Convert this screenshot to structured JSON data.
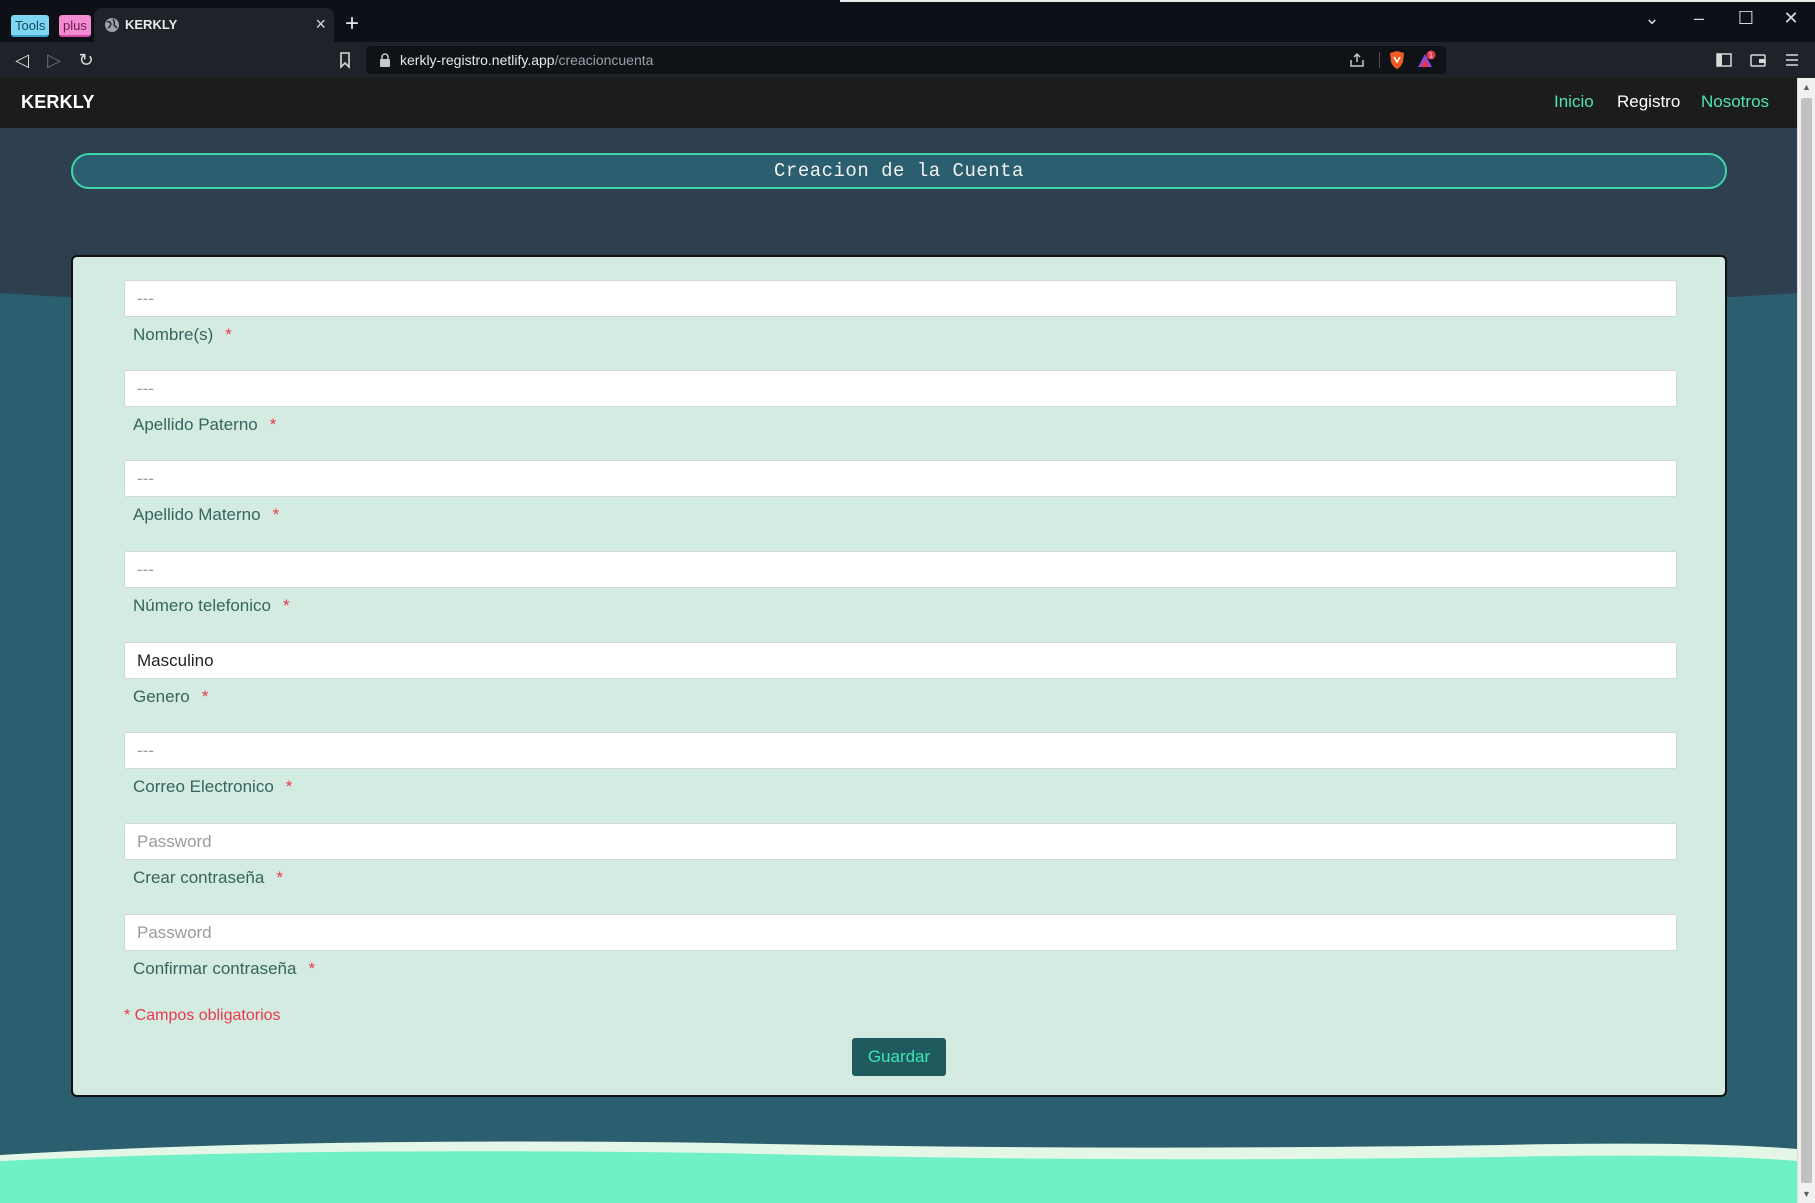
{
  "browser": {
    "tab_groups": [
      "Tools",
      "plus"
    ],
    "active_tab_title": "KERKLY",
    "url_host": "kerkly-registro.netlify.app",
    "url_path": "/creacioncuenta",
    "badge_count": "1"
  },
  "navbar": {
    "brand": "KERKLY",
    "links": [
      "Inicio",
      "Registro",
      "Nosotros"
    ]
  },
  "page_title": "Creacion de la Cuenta",
  "form": {
    "fields": [
      {
        "placeholder": "---",
        "value": "",
        "label": "Nombre(s)"
      },
      {
        "placeholder": "---",
        "value": "",
        "label": "Apellido Paterno"
      },
      {
        "placeholder": "---",
        "value": "",
        "label": "Apellido Materno"
      },
      {
        "placeholder": "---",
        "value": "",
        "label": "Número telefonico"
      },
      {
        "placeholder": "",
        "value": "Masculino",
        "label": "Genero"
      },
      {
        "placeholder": "---",
        "value": "",
        "label": "Correo Electronico"
      },
      {
        "placeholder": "Password",
        "value": "",
        "label": "Crear contraseña"
      },
      {
        "placeholder": "Password",
        "value": "",
        "label": "Confirmar contraseña"
      }
    ],
    "required_mark": "*",
    "required_note": "* Campos obligatorios",
    "submit_label": "Guardar"
  },
  "colors": {
    "page_bg": "#2b5e6e",
    "accent": "#4fe3b5",
    "card_bg": "#d4ebe2",
    "required": "#e8394b"
  }
}
